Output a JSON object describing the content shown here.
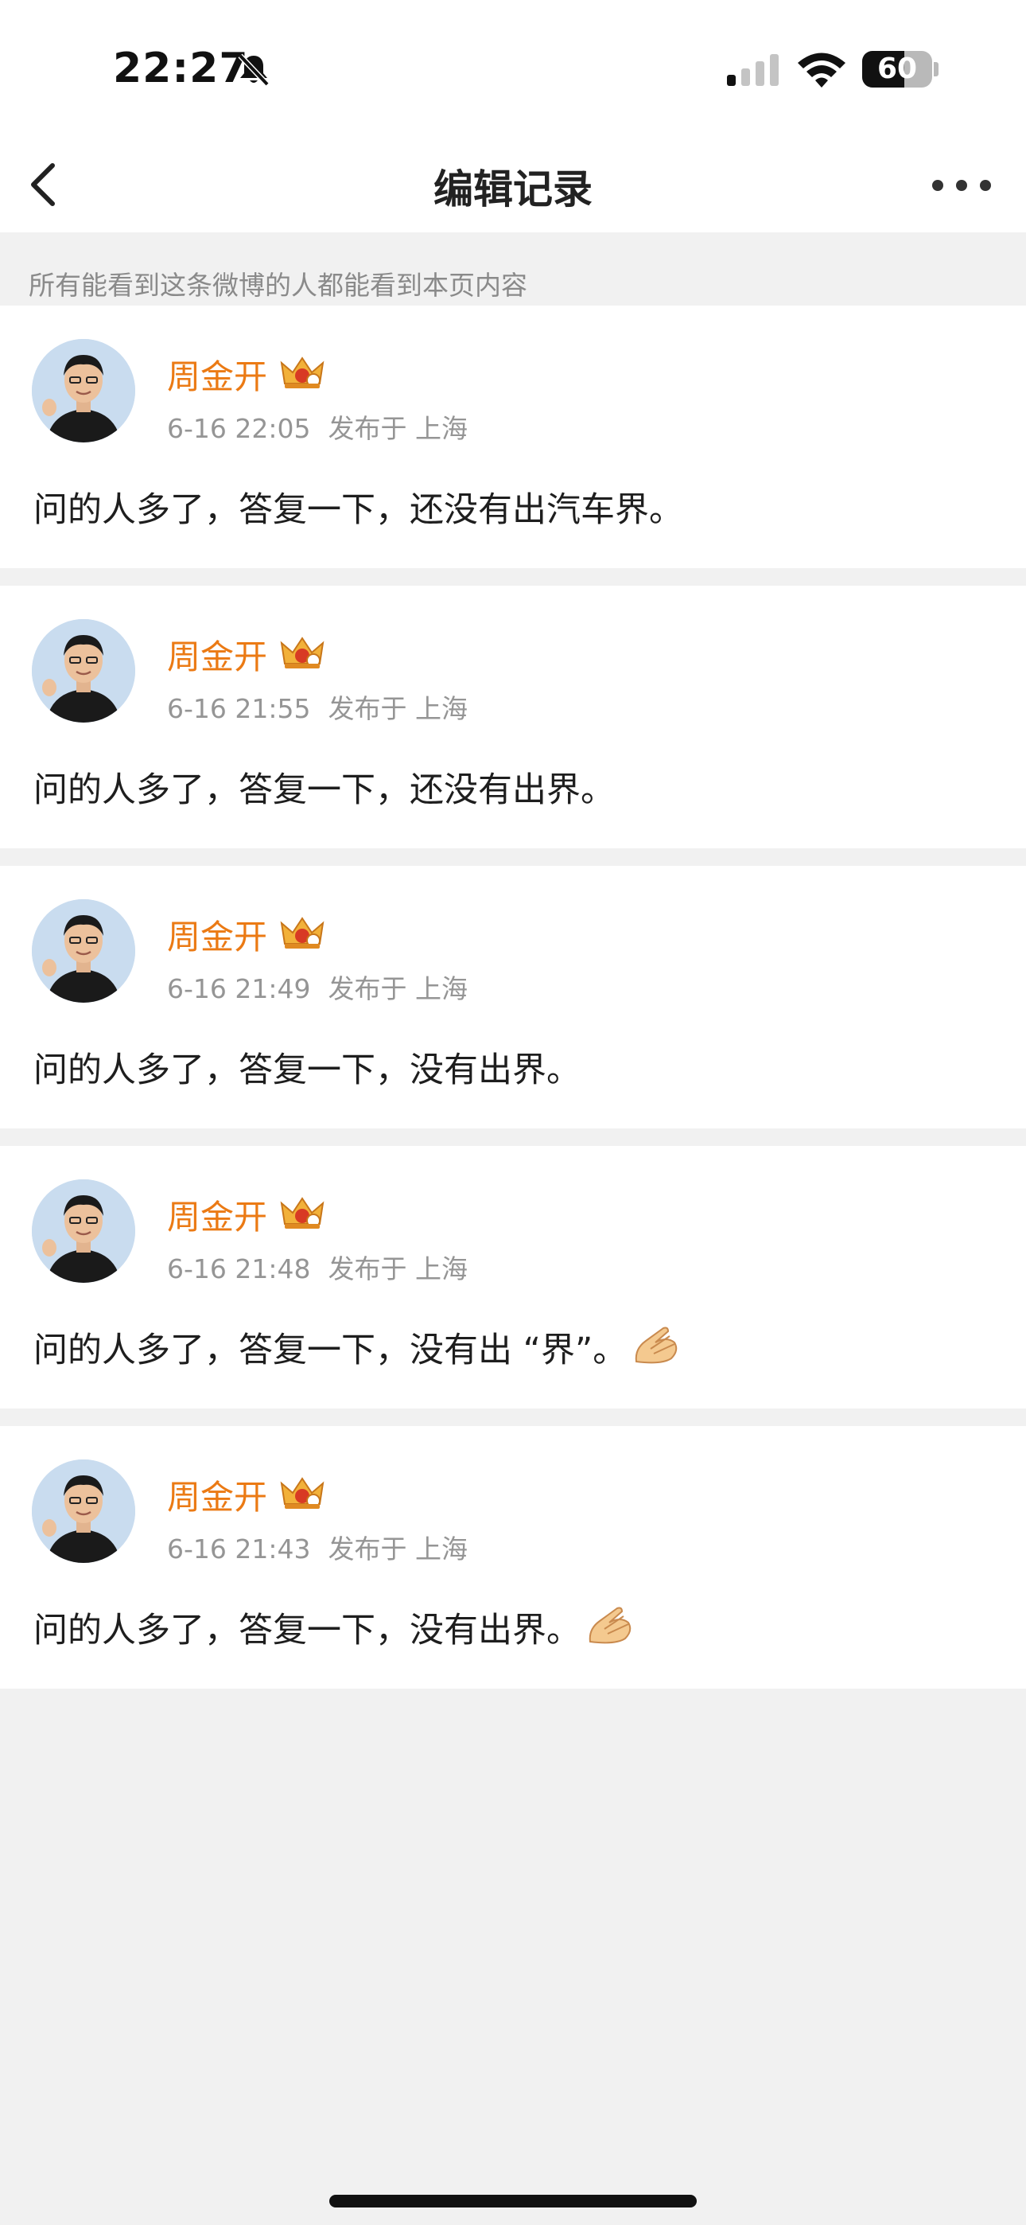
{
  "status_bar": {
    "time": "22:27",
    "battery": "60",
    "battery_level": 0.6
  },
  "nav": {
    "title": "编辑记录"
  },
  "notice": "所有能看到这条微博的人都能看到本页内容",
  "records": [
    {
      "author": "周金开",
      "time": "6-16 22:05",
      "location": "发布于 上海",
      "text": "问的人多了，答复一下，还没有出汽车界。",
      "emoji": false
    },
    {
      "author": "周金开",
      "time": "6-16 21:55",
      "location": "发布于 上海",
      "text": "问的人多了，答复一下，还没有出界。",
      "emoji": false
    },
    {
      "author": "周金开",
      "time": "6-16 21:49",
      "location": "发布于 上海",
      "text": "问的人多了，答复一下，没有出界。",
      "emoji": false
    },
    {
      "author": "周金开",
      "time": "6-16 21:48",
      "location": "发布于 上海",
      "text": "问的人多了，答复一下，没有出 “界”。",
      "emoji": true
    },
    {
      "author": "周金开",
      "time": "6-16 21:43",
      "location": "发布于 上海",
      "text": "问的人多了，答复一下，没有出界。",
      "emoji": true
    }
  ],
  "icons": {
    "back": "chevron-left-icon",
    "more": "more-dots-icon",
    "crown": "vip-crown-icon",
    "emoji": "pray-hands-emoji"
  },
  "colors": {
    "author": "#eb7a14",
    "meta": "#959595",
    "background": "#f1f1f1"
  }
}
